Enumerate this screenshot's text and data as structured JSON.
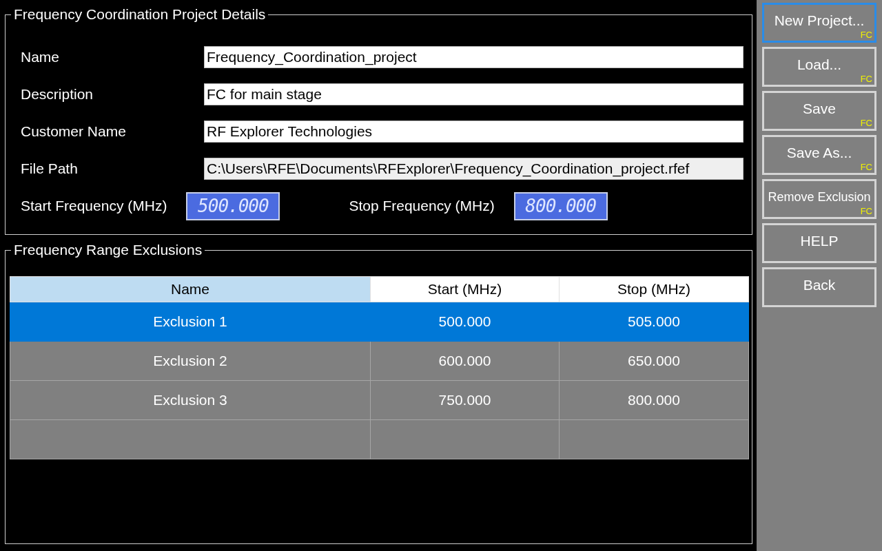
{
  "project_details": {
    "title": "Frequency Coordination Project Details",
    "fields": [
      {
        "label": "Name",
        "value": "Frequency_Coordination_project",
        "readonly": false
      },
      {
        "label": "Description",
        "value": "FC for main stage",
        "readonly": false
      },
      {
        "label": "Customer Name",
        "value": "RF Explorer Technologies",
        "readonly": false
      },
      {
        "label": "File Path",
        "value": "C:\\Users\\RFE\\Documents\\RFExplorer\\Frequency_Coordination_project.rfef",
        "readonly": true
      }
    ],
    "frequencies": [
      {
        "label": "Start Frequency (MHz)",
        "value": "500.000"
      },
      {
        "label": "Stop Frequency (MHz)",
        "value": "800.000"
      }
    ]
  },
  "exclusions": {
    "title": "Frequency Range Exclusions",
    "columns": [
      {
        "label": "Name",
        "highlighted": true
      },
      {
        "label": "Start (MHz)",
        "highlighted": false
      },
      {
        "label": "Stop (MHz)",
        "highlighted": false
      }
    ],
    "rows": [
      {
        "kind": "data",
        "selected": true,
        "cells": [
          "Exclusion 1",
          "500.000",
          "505.000"
        ]
      },
      {
        "kind": "data",
        "selected": false,
        "cells": [
          "Exclusion 2",
          "600.000",
          "650.000"
        ]
      },
      {
        "kind": "data",
        "selected": false,
        "cells": [
          "Exclusion 3",
          "750.000",
          "800.000"
        ]
      },
      {
        "kind": "empty",
        "selected": false
      }
    ]
  },
  "sidebar": {
    "buttons": [
      {
        "label": "New Project...",
        "badge": "FC",
        "focused": true
      },
      {
        "label": "Load...",
        "badge": "FC",
        "focused": false
      },
      {
        "label": "Save",
        "badge": "FC",
        "focused": false
      },
      {
        "label": "Save As...",
        "badge": "FC",
        "focused": false
      },
      {
        "label": "Remove Exclusion",
        "badge": "FC",
        "focused": false
      },
      {
        "label": "HELP",
        "focused": false
      },
      {
        "label": "Back",
        "focused": false
      }
    ]
  }
}
